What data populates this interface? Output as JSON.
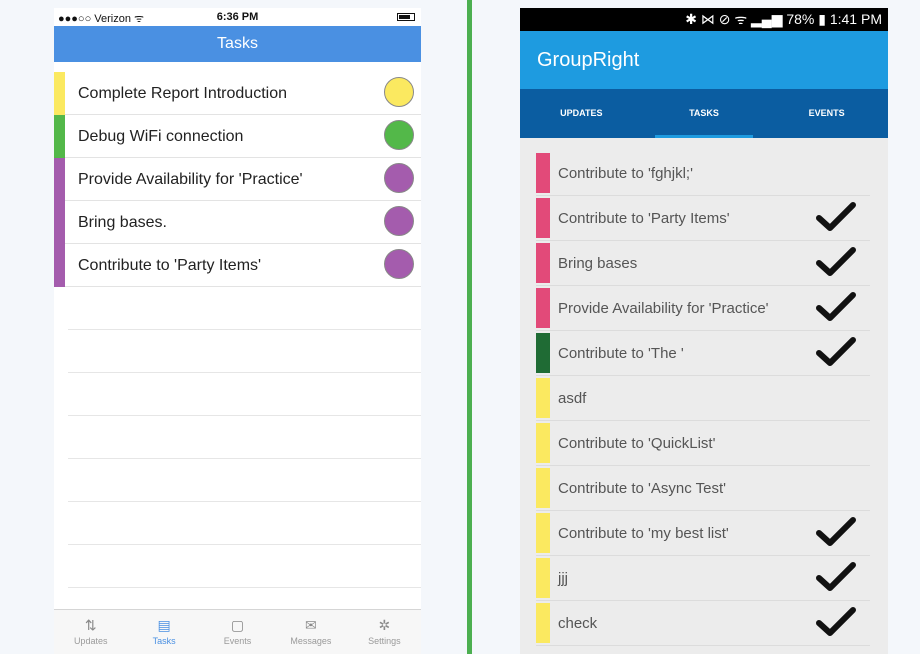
{
  "colors": {
    "ios_nav": "#4a90e2",
    "yellow": "#fbe960",
    "green": "#53b849",
    "purple": "#a45cad",
    "pink": "#e24a79",
    "dark_green": "#1f6b34",
    "android_appbar": "#1e9be0",
    "android_tabs": "#0b5da1"
  },
  "ios": {
    "status": {
      "carrier": "●●●○○ Verizon ᯤ",
      "time": "6:36 PM"
    },
    "title": "Tasks",
    "tasks": [
      {
        "label": "Complete Report Introduction",
        "color": "#fbe960"
      },
      {
        "label": "Debug WiFi connection",
        "color": "#53b849"
      },
      {
        "label": "Provide Availability for 'Practice'",
        "color": "#a45cad"
      },
      {
        "label": "Bring bases.",
        "color": "#a45cad"
      },
      {
        "label": "Contribute to 'Party Items'",
        "color": "#a45cad"
      }
    ],
    "tabbar": [
      {
        "label": "Updates",
        "icon": "updates-icon",
        "glyph": "⇅"
      },
      {
        "label": "Tasks",
        "icon": "clipboard-icon",
        "glyph": "▤"
      },
      {
        "label": "Events",
        "icon": "calendar-icon",
        "glyph": "▢"
      },
      {
        "label": "Messages",
        "icon": "envelope-icon",
        "glyph": "✉"
      },
      {
        "label": "Settings",
        "icon": "gear-icon",
        "glyph": "✲"
      }
    ]
  },
  "android": {
    "status": "✱ ⋈ ⊘ ᯤ ▂▄▆ 78% ▮ 1:41 PM",
    "app_title": "GroupRight",
    "tabs": [
      "UPDATES",
      "TASKS",
      "EVENTS"
    ],
    "tasks": [
      {
        "label": "Contribute to 'fghjkl;'",
        "color": "#e24a79",
        "checked": false
      },
      {
        "label": "Contribute to 'Party Items'",
        "color": "#e24a79",
        "checked": true
      },
      {
        "label": "Bring bases",
        "color": "#e24a79",
        "checked": true
      },
      {
        "label": "Provide Availability for 'Practice'",
        "color": "#e24a79",
        "checked": true
      },
      {
        "label": "Contribute to 'The '",
        "color": "#1f6b34",
        "checked": true
      },
      {
        "label": "asdf",
        "color": "#fbe960",
        "checked": false
      },
      {
        "label": "Contribute to 'QuickList'",
        "color": "#fbe960",
        "checked": false
      },
      {
        "label": "Contribute to 'Async Test'",
        "color": "#fbe960",
        "checked": false
      },
      {
        "label": "Contribute to 'my best list'",
        "color": "#fbe960",
        "checked": true
      },
      {
        "label": "jjj",
        "color": "#fbe960",
        "checked": true
      },
      {
        "label": "check",
        "color": "#fbe960",
        "checked": true
      }
    ]
  }
}
